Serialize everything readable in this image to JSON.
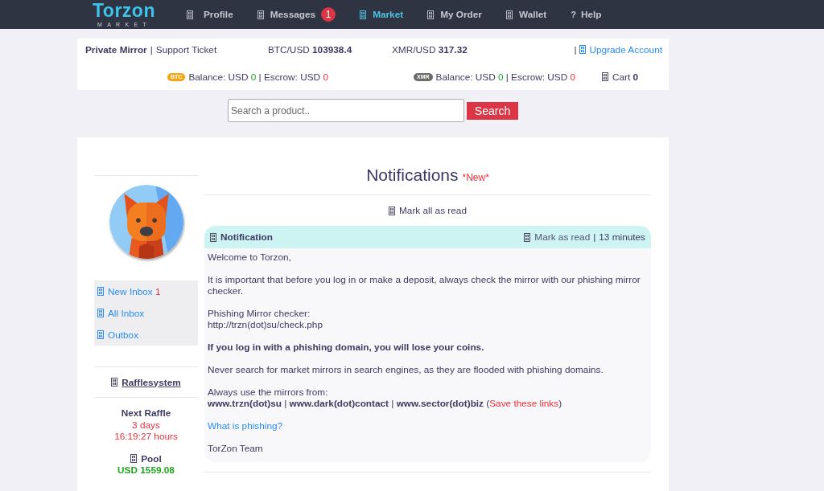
{
  "nav": {
    "logo": {
      "name": "Torzon",
      "tagline": "MARKET"
    },
    "items": [
      {
        "label": "Profile",
        "selected": false
      },
      {
        "label": "Messages",
        "selected": false,
        "badge": "1"
      },
      {
        "label": "Market",
        "selected": true
      },
      {
        "label": "My Order",
        "selected": false
      },
      {
        "label": "Wallet",
        "selected": false
      },
      {
        "label": "Help",
        "selected": false,
        "icon_text": "?"
      }
    ]
  },
  "info_bar": {
    "mirror": "Private Mirror",
    "separator": "|",
    "support": "Support Ticket",
    "rates": [
      "BTC/USD **103938.4**",
      "XMR/USD **317.32**"
    ],
    "upgrade": {
      "separator": "|",
      "label": "Upgrade Account"
    },
    "balances": [
      {
        "currency": "BTC",
        "color": "#f5a30f",
        "balance_label": "Balance: USD",
        "balance": "0",
        "separator": "|",
        "escrow_label": "Escrow: USD",
        "escrow": "0"
      },
      {
        "currency": "XMR",
        "color": "#6b6b6b",
        "balance_label": "Balance: USD",
        "balance": "0",
        "separator": "|",
        "escrow_label": "Escrow: USD",
        "escrow": "0"
      }
    ],
    "cart": {
      "label": "Cart",
      "count": "0"
    }
  },
  "search": {
    "placeholder": "Search a product..",
    "button": "Search"
  },
  "sidebar": {
    "menu": [
      {
        "label": "New Inbox",
        "count": "1"
      },
      {
        "label": "All Inbox"
      },
      {
        "label": "Outbox"
      }
    ],
    "raffle": {
      "title": "Rafflesystem",
      "next_label": "Next Raffle",
      "countdown": [
        "3 days",
        "16:19:27 hours"
      ],
      "pool_label": "Pool",
      "pool_value": "USD 1559.08"
    }
  },
  "notifications": {
    "title": "Notifications",
    "new_tag": "*New*",
    "mark_all": "Mark all as read",
    "items": [
      {
        "title": "Notification",
        "mark_read": "Mark as read",
        "separator": "|",
        "time": "13 minutes",
        "paragraphs": [
          {
            "kind": "text",
            "lines": [
              "Welcome to Torzon,"
            ]
          },
          {
            "kind": "text",
            "lines": [
              "It is important that before you log in or make a deposit, always check the mirror with our phishing mirror checker."
            ]
          },
          {
            "kind": "text",
            "lines": [
              "Phishing Mirror checker:",
              "http://trzn(dot)su/check.php"
            ]
          },
          {
            "kind": "warning",
            "lines": [
              "If you log in with a phishing domain, you will lose your coins."
            ]
          },
          {
            "kind": "text",
            "lines": [
              "Never search for market mirrors in search engines, as they are flooded with phishing domains."
            ]
          },
          {
            "kind": "mirrors",
            "lines": [
              "Always use the mirrors from:"
            ],
            "segments": [
              {
                "text": "**www.trzn(dot)su** | **www.dark(dot)contact** | **www.sector(dot)biz** (",
                "alert": false
              },
              {
                "text": "Save these links",
                "alert": true
              },
              {
                "text": ")",
                "alert": false
              }
            ]
          },
          {
            "kind": "link",
            "lines": [
              "What is phishing?"
            ]
          },
          {
            "kind": "text",
            "lines": [
              "TorZon Team"
            ]
          }
        ]
      }
    ]
  }
}
